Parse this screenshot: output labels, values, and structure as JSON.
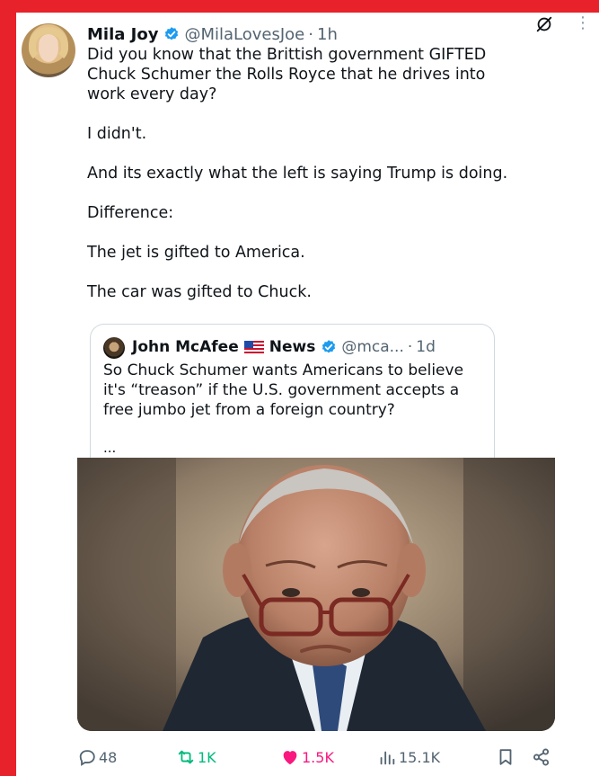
{
  "tweet": {
    "author_name": "Mila Joy",
    "handle": "@MilaLovesJoe",
    "separator": "·",
    "time": "1h",
    "more": "⋮",
    "paragraphs": [
      "Did you know that the Brittish government GIFTED Chuck Schumer the Rolls Royce that he drives into work every day?",
      "I didn't.",
      "And its exactly what the left is saying Trump is doing.",
      "Difference:",
      "The jet is gifted to America.",
      "The car was gifted to Chuck."
    ]
  },
  "quote": {
    "author_name": "John McAfee",
    "author_suffix": "News",
    "handle": "@mca...",
    "separator": "·",
    "time": "1d",
    "text": "So Chuck Schumer wants Americans to believe it's “treason” if the U.S. government accepts a free jumbo jet from a foreign country?",
    "ellipsis": "..."
  },
  "actions": {
    "replies": "48",
    "reposts": "1K",
    "likes": "1.5K",
    "views": "15.1K"
  },
  "colors": {
    "background_frame": "#e8222a",
    "verified_blue": "#1d9bf0",
    "repost_green": "#00ba7c",
    "like_pink": "#f91880",
    "muted_gray": "#536471"
  },
  "icons": {
    "verified": "verified-badge-icon",
    "mute": "mute-icon",
    "more": "more-icon",
    "reply": "reply-icon",
    "repost": "repost-icon",
    "like": "heart-icon",
    "views": "views-icon",
    "bookmark": "bookmark-icon",
    "share": "share-icon"
  }
}
